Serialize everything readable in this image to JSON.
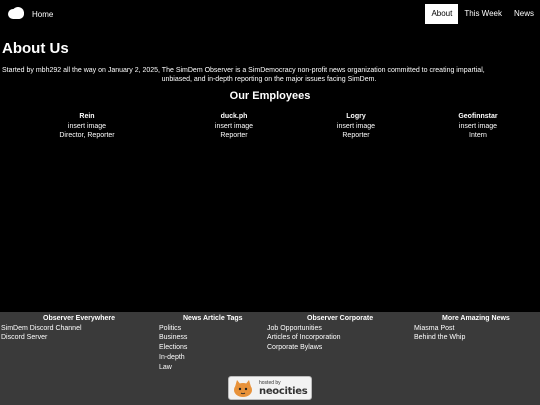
{
  "nav": {
    "home": "Home",
    "links": [
      "About",
      "This Week",
      "News"
    ],
    "active": "About"
  },
  "about": {
    "title": "About Us",
    "text_line1": "Started by mbh292 all the way on January 2, 2025, The SimDem Observer is a SimDemocracy non-profit news organization committed to creating impartial,",
    "text_line2": "unbiased, and in-depth reporting on the major issues facing SimDem."
  },
  "employees": {
    "title": "Our Employees",
    "list": [
      {
        "name": "Rein",
        "image": "insert image",
        "role": "Director, Reporter"
      },
      {
        "name": "duck.ph",
        "image": "insert image",
        "role": "Reporter"
      },
      {
        "name": "Logry",
        "image": "insert image",
        "role": "Reporter"
      },
      {
        "name": "Geofinnstar",
        "image": "insert image",
        "role": "Intern"
      }
    ]
  },
  "footer": {
    "col1": {
      "heading": "Observer Everywhere",
      "links": [
        "SimDem Discord Channel",
        "Discord Server"
      ]
    },
    "col2": {
      "heading": "News Article Tags",
      "links": [
        "Politics",
        "Business",
        "Elections",
        "In-depth",
        "Law"
      ]
    },
    "col3": {
      "heading": "Observer Corporate",
      "links": [
        "Job Opportunities",
        "Articles of Incorporation",
        "Corporate Bylaws"
      ]
    },
    "col4": {
      "heading": "More Amazing News",
      "links": [
        "Miasma Post",
        "Behind the Whip"
      ]
    },
    "badge": {
      "hosted": "hosted by",
      "brand": "neocities"
    }
  },
  "colors": {
    "background": "#000000",
    "footer": "#3a3a3a",
    "cat": "#e8923a"
  }
}
